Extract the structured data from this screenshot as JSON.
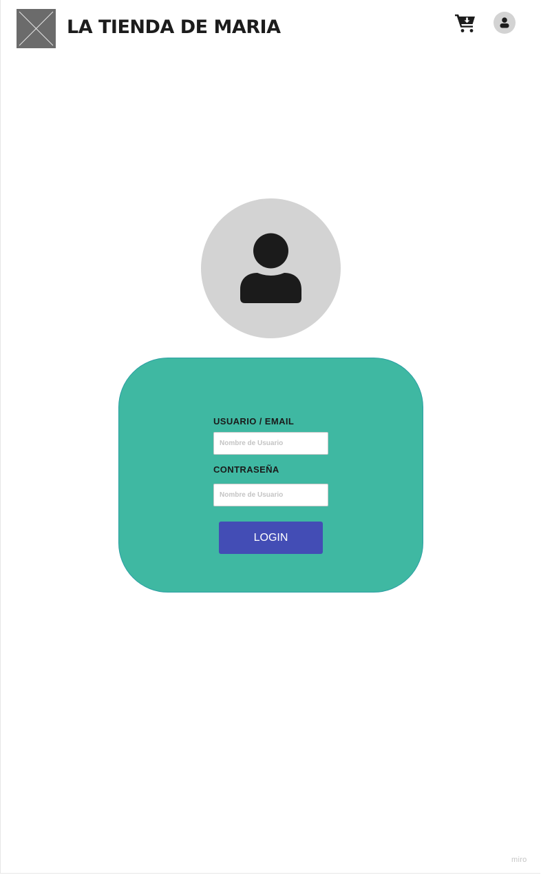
{
  "header": {
    "brand": "LA TIENDA DE MARIA",
    "logo_icon": "image-placeholder-icon",
    "cart_icon": "cart-download-icon",
    "account_icon": "user-icon"
  },
  "login": {
    "avatar_icon": "user-icon",
    "username_label": "USUARIO / EMAIL",
    "username_placeholder": "Nombre de Usuario",
    "password_label": "CONTRASEÑA",
    "password_placeholder": "Nombre de Usuario",
    "button_label": "LOGIN"
  },
  "colors": {
    "card": "#3fb8a2",
    "button": "#434db5",
    "avatar_bg": "#d3d3d3",
    "logo_bg": "#6b6b6b"
  },
  "watermark": "miro"
}
